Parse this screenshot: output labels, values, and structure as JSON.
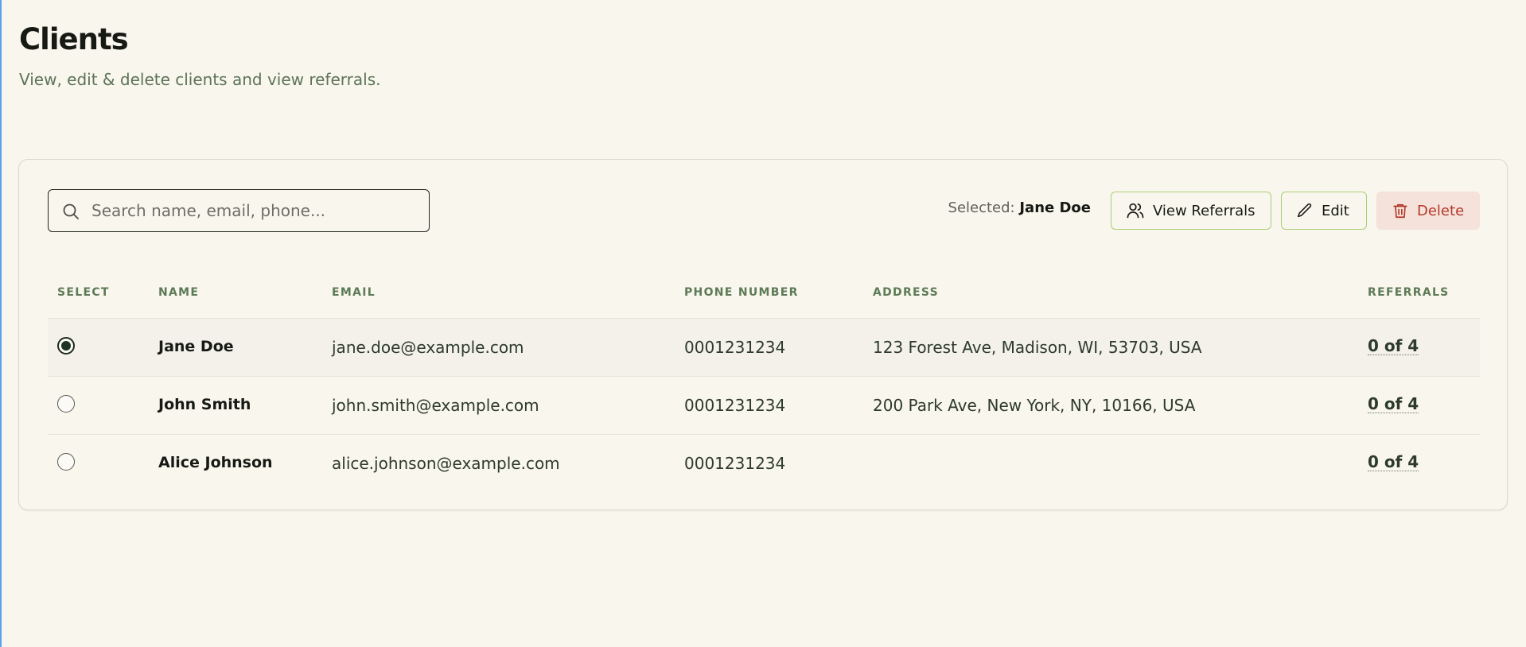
{
  "page": {
    "title": "Clients",
    "subtitle": "View, edit & delete clients and view referrals."
  },
  "toolbar": {
    "search_placeholder": "Search name, email, phone...",
    "search_value": "",
    "selected_prefix": "Selected:",
    "selected_name": "Jane Doe",
    "view_referrals_label": "View Referrals",
    "edit_label": "Edit",
    "delete_label": "Delete"
  },
  "table": {
    "headers": {
      "select": "SELECT",
      "name": "NAME",
      "email": "EMAIL",
      "phone": "PHONE NUMBER",
      "address": "ADDRESS",
      "referrals": "REFERRALS"
    },
    "rows": [
      {
        "selected": true,
        "name": "Jane Doe",
        "email": "jane.doe@example.com",
        "phone": "0001231234",
        "address": "123 Forest Ave, Madison, WI, 53703, USA",
        "referrals": "0 of 4"
      },
      {
        "selected": false,
        "name": "John Smith",
        "email": "john.smith@example.com",
        "phone": "0001231234",
        "address": "200 Park Ave, New York, NY, 10166, USA",
        "referrals": "0 of 4"
      },
      {
        "selected": false,
        "name": "Alice Johnson",
        "email": "alice.johnson@example.com",
        "phone": "0001231234",
        "address": "",
        "referrals": "0 of 4"
      }
    ]
  },
  "colors": {
    "background": "#f9f6ee",
    "accent_border": "#a9cf74",
    "danger_bg": "#f4e2db",
    "danger_text": "#b33a2b",
    "header_text": "#5d7a56"
  },
  "icons": {
    "search": "search-icon",
    "view_referrals": "users-icon",
    "edit": "pencil-icon",
    "delete": "trash-icon"
  }
}
